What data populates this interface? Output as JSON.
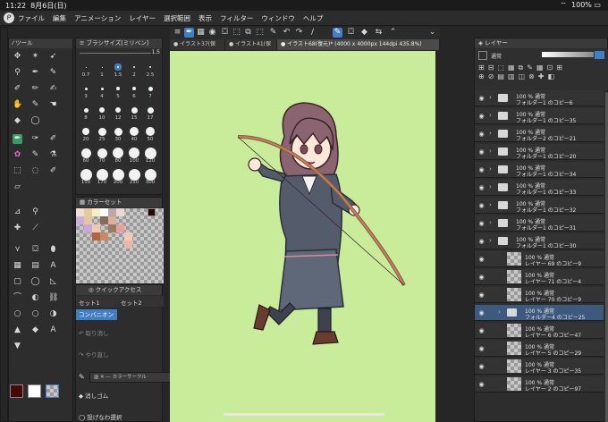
{
  "status": {
    "time": "11:22",
    "date": "8月6日(日)",
    "battery": "100%"
  },
  "menu": [
    "ファイル",
    "編集",
    "アニメーション",
    "レイヤー",
    "選択範囲",
    "表示",
    "フィルター",
    "ウィンドウ",
    "ヘルプ"
  ],
  "panels": {
    "tool_tab": "ツール",
    "brush_size_tab": "ブラシサイズ[ミリペン]",
    "brush_size_value": "1.5",
    "color_set_tab": "カラーセット",
    "quick_tab": "クイックアクセス",
    "layer_tab": "レイヤー"
  },
  "brush_sizes": [
    "0.7",
    "1",
    "1.5",
    "2",
    "2.5",
    "3",
    "4",
    "5",
    "6",
    "7",
    "8",
    "10",
    "12",
    "15",
    "17",
    "20",
    "25",
    "30",
    "40",
    "50",
    "60",
    "70",
    "80",
    "100",
    "120",
    "150",
    "170",
    "200",
    "250",
    "300"
  ],
  "quick": {
    "tabs": [
      "セット1",
      "セット2"
    ],
    "active": "コンバニオン",
    "items": [
      "取り消し",
      "やり直し",
      "カラーサークル",
      "消しゴム",
      "投げなわ選択"
    ]
  },
  "doc_tabs": [
    "イラスト37(保",
    "イラスト41(保",
    "イラスト68(復元)* (4000 x 4000px 144dpi 435.8%)"
  ],
  "layer_blend": "通常",
  "layers": [
    {
      "pct": "100 % 通常",
      "name": "フォルダー1 のコピー6",
      "type": "folder"
    },
    {
      "pct": "100 % 通常",
      "name": "フォルダー1 のコピー35",
      "type": "folder"
    },
    {
      "pct": "100 % 通常",
      "name": "フォルダー2 のコピー21",
      "type": "folder"
    },
    {
      "pct": "100 % 通常",
      "name": "フォルダー1 のコピー20",
      "type": "folder"
    },
    {
      "pct": "100 % 通常",
      "name": "フォルダー1 のコピー34",
      "type": "folder"
    },
    {
      "pct": "100 % 通常",
      "name": "フォルダー1 のコピー33",
      "type": "folder"
    },
    {
      "pct": "100 % 通常",
      "name": "フォルダー1 のコピー32",
      "type": "folder"
    },
    {
      "pct": "100 % 通常",
      "name": "フォルダー1 のコピー31",
      "type": "folder"
    },
    {
      "pct": "100 % 通常",
      "name": "フォルダー1 のコピー30",
      "type": "folder"
    },
    {
      "pct": "100 % 通常",
      "name": "レイヤー 69 のコピー9",
      "type": "layer"
    },
    {
      "pct": "100 % 通常",
      "name": "レイヤー 71 のコピー4",
      "type": "layer"
    },
    {
      "pct": "100 % 通常",
      "name": "レイヤー 70 のコピー9",
      "type": "layer"
    },
    {
      "pct": "100 % 通常",
      "name": "フォルダー4 のコピー25",
      "type": "folder"
    },
    {
      "pct": "100 % 通常",
      "name": "レイヤー 6 のコピー47",
      "type": "layer"
    },
    {
      "pct": "100 % 通常",
      "name": "レイヤー 5 のコピー29",
      "type": "layer"
    },
    {
      "pct": "100 % 通常",
      "name": "レイヤー 3 のコピー35",
      "type": "layer"
    },
    {
      "pct": "100 % 通常",
      "name": "レイヤー 2 のコピー97",
      "type": "layer"
    }
  ]
}
